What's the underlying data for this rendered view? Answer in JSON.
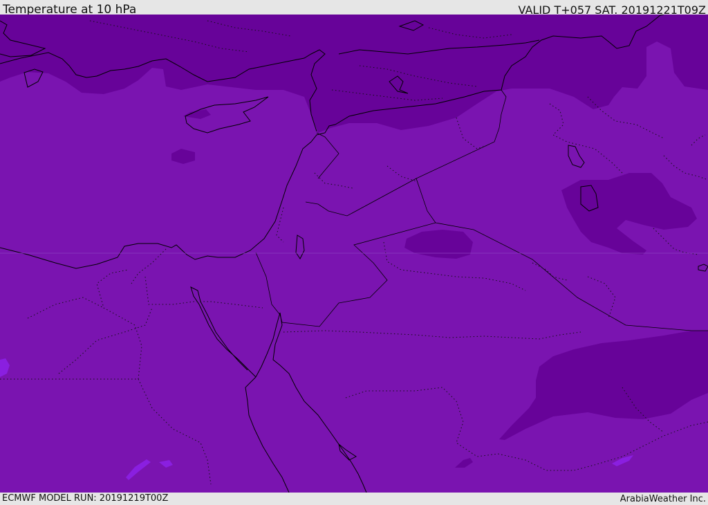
{
  "header": {
    "title": "Temperature at 10 hPa",
    "valid": "VALID T+057 SAT. 20191221T09Z"
  },
  "footer": {
    "model_run": "ECMWF MODEL RUN: 20191219T00Z",
    "credit": "ArabiaWeather Inc."
  },
  "map": {
    "colors": {
      "base_field": "#7a14b0",
      "cold_field": "#670399",
      "light_patch": "#8a1fe0",
      "frame": "#e6e6e6"
    }
  }
}
